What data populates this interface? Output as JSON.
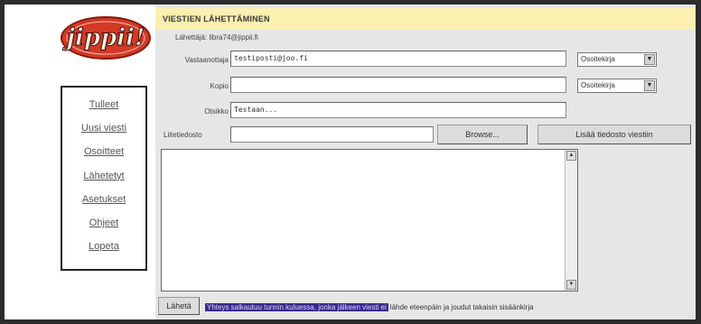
{
  "app": {
    "logo_text": "jippii!",
    "header_title": "VIESTIEN LÄHETTÄMINEN",
    "sender_label": "Lähettäjä:",
    "sender_value": "libra74@jippii.fi"
  },
  "nav": {
    "items": [
      {
        "label": "Tulleet"
      },
      {
        "label": "Uusi viesti"
      },
      {
        "label": "Osoitteet"
      },
      {
        "label": "Lähetetyt"
      },
      {
        "label": "Asetukset"
      },
      {
        "label": "Ohjeet"
      },
      {
        "label": "Lopeta"
      }
    ]
  },
  "form": {
    "to_label": "Vastaanottaja",
    "to_value": "testiposti@joo.fi",
    "cc_label": "Kopio",
    "cc_value": "",
    "subject_label": "Otsikko",
    "subject_value": "Testaan...",
    "attachment_label": "Liitetiedosto",
    "attachment_value": "",
    "address_book_select": "Osoitekirja",
    "browse_button": "Browse...",
    "add_file_button": "Lisää tiedosto viestiin",
    "body_value": "",
    "send_button": "Lähetä"
  },
  "status": {
    "highlight_text": "Yhteys salkautuu tunnin kuluessa, jonka jälkeen viesti ei",
    "rest_text": "lähde eteenpäin ja joudut takaisin sisäänkirja"
  },
  "colors": {
    "header_bg": "#fbf0b0",
    "selection": "#3a2a8c",
    "panel_bg": "#e6e6e6"
  }
}
